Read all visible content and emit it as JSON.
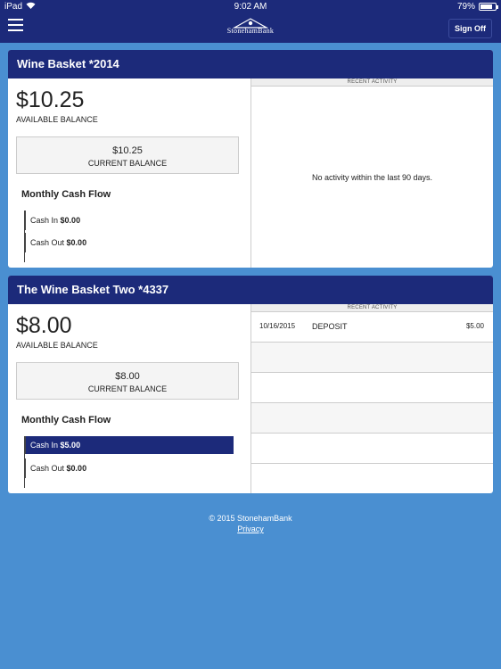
{
  "status_bar": {
    "device": "iPad",
    "time": "9:02 AM",
    "battery": "79%",
    "battery_level": 0.79
  },
  "navbar": {
    "logo_text": "StonehamBank",
    "sign_off_label": "Sign Off"
  },
  "accounts": [
    {
      "title": "Wine Basket *2014",
      "available_balance": "$10.25",
      "available_label": "AVAILABLE BALANCE",
      "current_balance": "$10.25",
      "current_label": "CURRENT BALANCE",
      "cash_flow_title": "Monthly Cash Flow",
      "cash_in_label": "Cash In",
      "cash_in_value": "$0.00",
      "cash_out_label": "Cash Out",
      "cash_out_value": "$0.00",
      "recent_activity_header": "RECENT ACTIVITY",
      "no_activity_text": "No activity within the last 90 days."
    },
    {
      "title": "The Wine Basket Two *4337",
      "available_balance": "$8.00",
      "available_label": "AVAILABLE BALANCE",
      "current_balance": "$8.00",
      "current_label": "CURRENT BALANCE",
      "cash_flow_title": "Monthly Cash Flow",
      "cash_in_label": "Cash In",
      "cash_in_value": "$5.00",
      "cash_out_label": "Cash Out",
      "cash_out_value": "$0.00",
      "recent_activity_header": "RECENT ACTIVITY",
      "transactions": [
        {
          "date": "10/16/2015",
          "description": "DEPOSIT",
          "amount": "$5.00"
        }
      ]
    }
  ],
  "footer": {
    "copyright": "© 2015 StonehamBank",
    "privacy_label": "Privacy"
  },
  "colors": {
    "background": "#4a8fd1",
    "navy": "#1c2a7a"
  }
}
